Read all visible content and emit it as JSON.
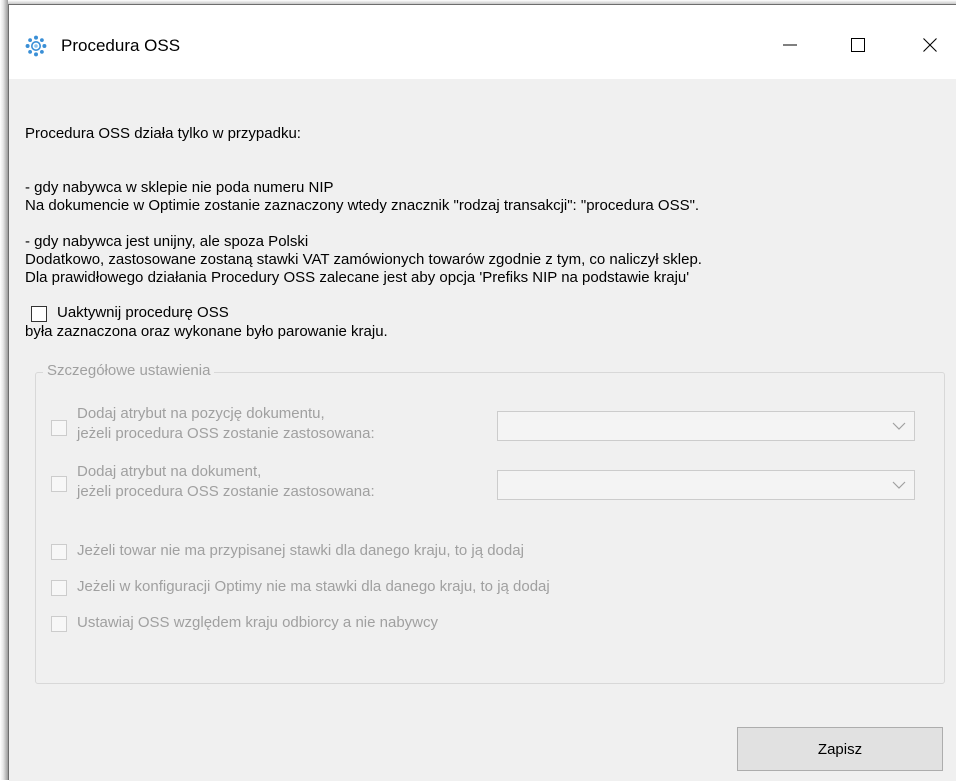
{
  "window": {
    "title": "Procedura OSS",
    "icon": "oss-gear-icon",
    "controls": {
      "minimize": "—",
      "maximize": "☐",
      "close": "✕"
    }
  },
  "info": {
    "paragraph1": [
      "Procedura OSS działa tylko w przypadku:",
      "- gdy nabywca w sklepie nie poda numeru NIP",
      "- gdy nabywca jest unijny, ale spoza Polski"
    ],
    "paragraph2": [
      "Na dokumencie w Optimie zostanie zaznaczony wtedy znacznik \"rodzaj transakcji\": \"procedura OSS\".",
      "Dodatkowo, zastosowane zostaną stawki VAT zamówionych towarów zgodnie z tym, co naliczył sklep."
    ],
    "paragraph3": [
      "Dla prawidłowego działania Procedury OSS zalecane jest aby opcja 'Prefiks NIP na podstawie kraju'",
      "była zaznaczona oraz wykonane było parowanie kraju."
    ]
  },
  "activate": {
    "label": "Uaktywnij procedurę OSS",
    "checked": false
  },
  "details": {
    "legend": "Szczegółowe ustawienia",
    "enabled": false,
    "attr_position": {
      "label_line1": "Dodaj atrybut na pozycję dokumentu,",
      "label_line2": "jeżeli procedura OSS zostanie zastosowana:",
      "checked": false,
      "selected": ""
    },
    "attr_document": {
      "label_line1": "Dodaj atrybut na dokument,",
      "label_line2": "jeżeli procedura OSS zostanie zastosowana:",
      "checked": false,
      "selected": ""
    },
    "options": [
      {
        "label": "Jeżeli towar nie ma przypisanej stawki dla danego kraju, to ją dodaj",
        "checked": false
      },
      {
        "label": "Jeżeli w konfiguracji Optimy nie ma stawki dla danego kraju, to ją dodaj",
        "checked": false
      },
      {
        "label": "Ustawiaj OSS względem kraju odbiorcy a nie nabywcy",
        "checked": false
      }
    ]
  },
  "actions": {
    "save_label": "Zapisz"
  },
  "colors": {
    "window_bg": "#f0f0f0",
    "disabled_text": "#a0a0a0",
    "icon_blue": "#3a8fd6"
  }
}
